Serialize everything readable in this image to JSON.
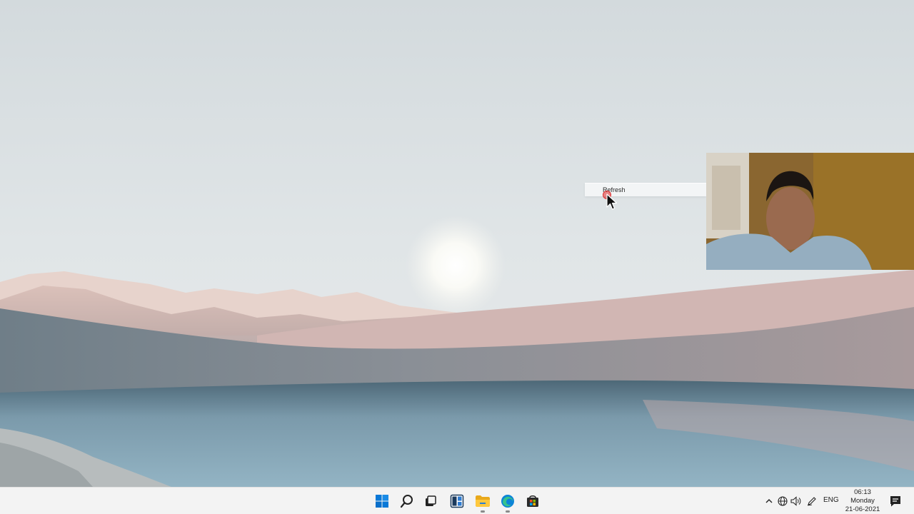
{
  "context_menu": {
    "items": [
      {
        "label": "Refresh"
      }
    ]
  },
  "taskbar": {
    "apps": [
      {
        "name": "start",
        "icon": "windows-logo-icon"
      },
      {
        "name": "search",
        "icon": "search-icon"
      },
      {
        "name": "task-view",
        "icon": "task-view-icon"
      },
      {
        "name": "widgets",
        "icon": "widgets-icon"
      },
      {
        "name": "file-explorer",
        "icon": "folder-icon"
      },
      {
        "name": "edge",
        "icon": "edge-browser-icon"
      },
      {
        "name": "store",
        "icon": "store-bag-icon"
      }
    ],
    "tray": {
      "icons": [
        "chevron-up-icon",
        "globe-network-icon",
        "speaker-icon",
        "pen-icon"
      ],
      "language": "ENG",
      "time": "06:13",
      "day": "Monday",
      "date": "21-06-2021"
    }
  },
  "colors": {
    "accent": "#0078d4",
    "taskbar_bg": "#f3f3f3",
    "click_marker": "#dc2828"
  }
}
